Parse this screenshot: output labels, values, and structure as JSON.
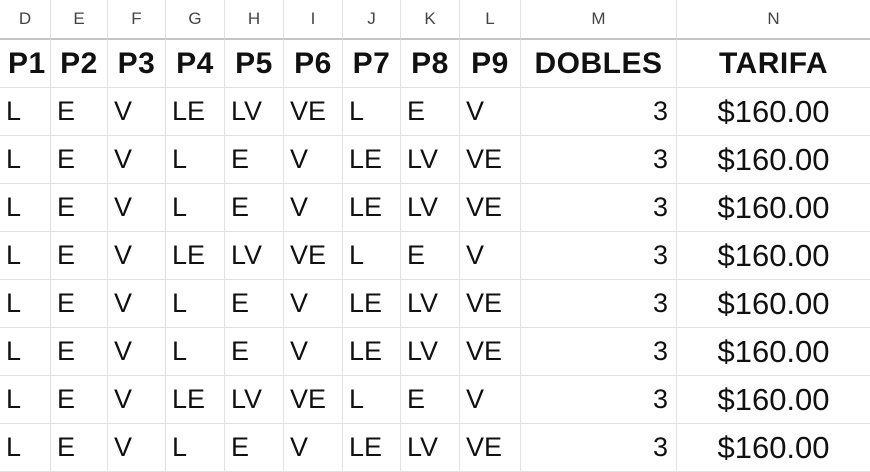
{
  "column_letters": [
    "D",
    "E",
    "F",
    "G",
    "H",
    "I",
    "J",
    "K",
    "L",
    "M",
    "N"
  ],
  "headers": [
    "P1",
    "P2",
    "P3",
    "P4",
    "P5",
    "P6",
    "P7",
    "P8",
    "P9",
    "DOBLES",
    "TARIFA"
  ],
  "rows": [
    [
      "L",
      "E",
      "V",
      "LE",
      "LV",
      "VE",
      "L",
      "E",
      "V",
      "3",
      "$160.00"
    ],
    [
      "L",
      "E",
      "V",
      "L",
      "E",
      "V",
      "LE",
      "LV",
      "VE",
      "3",
      "$160.00"
    ],
    [
      "L",
      "E",
      "V",
      "L",
      "E",
      "V",
      "LE",
      "LV",
      "VE",
      "3",
      "$160.00"
    ],
    [
      "L",
      "E",
      "V",
      "LE",
      "LV",
      "VE",
      "L",
      "E",
      "V",
      "3",
      "$160.00"
    ],
    [
      "L",
      "E",
      "V",
      "L",
      "E",
      "V",
      "LE",
      "LV",
      "VE",
      "3",
      "$160.00"
    ],
    [
      "L",
      "E",
      "V",
      "L",
      "E",
      "V",
      "LE",
      "LV",
      "VE",
      "3",
      "$160.00"
    ],
    [
      "L",
      "E",
      "V",
      "LE",
      "LV",
      "VE",
      "L",
      "E",
      "V",
      "3",
      "$160.00"
    ],
    [
      "L",
      "E",
      "V",
      "L",
      "E",
      "V",
      "LE",
      "LV",
      "VE",
      "3",
      "$160.00"
    ]
  ]
}
